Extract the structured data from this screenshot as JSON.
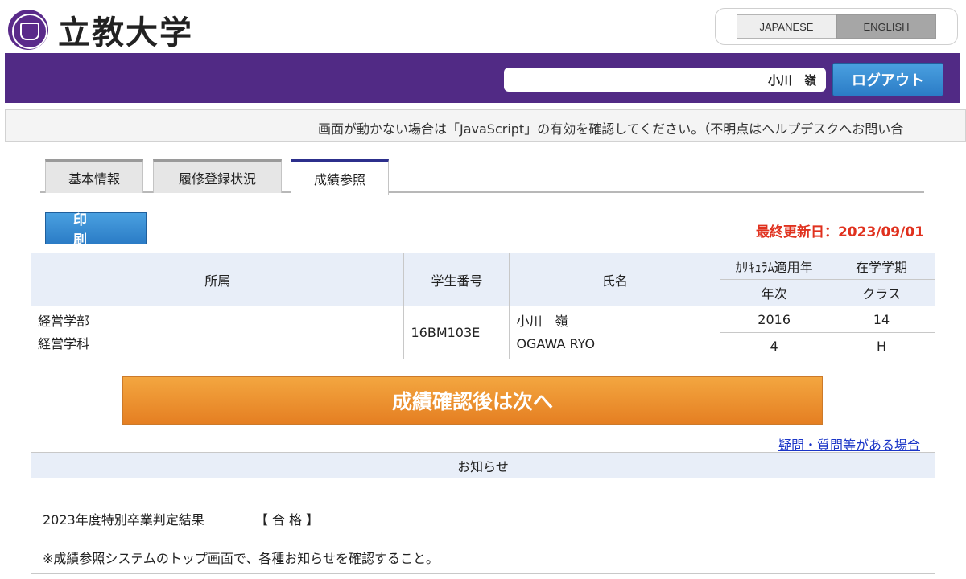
{
  "header": {
    "logo_text": "立教大学",
    "lang_japanese": "JAPANESE",
    "lang_english": "ENGLISH"
  },
  "user_bar": {
    "user_name": "小川　嶺",
    "logout_label": "ログアウト"
  },
  "notice_bar": {
    "text": "画面が動かない場合は「JavaScript」の有効を確認してください。（不明点はヘルプデスクへお問い合"
  },
  "tabs": [
    {
      "label": "基本情報",
      "active": false
    },
    {
      "label": "履修登録状況",
      "active": false
    },
    {
      "label": "成績参照",
      "active": true
    }
  ],
  "toolbar": {
    "print_label": "印刷",
    "last_update": "最終更新日：2023/09/01"
  },
  "info_table": {
    "headers": {
      "affiliation": "所属",
      "student_id": "学生番号",
      "name": "氏名",
      "curriculum_year": "ｶﾘｷｭﾗﾑ適用年",
      "enrollment_term": "在学学期",
      "grade_year": "年次",
      "class": "クラス"
    },
    "values": {
      "faculty": "経営学部",
      "department": "経営学科",
      "student_id": "16BM103E",
      "name_kanji": "小川　嶺",
      "name_roman": "OGAWA RYO",
      "curriculum_year": "2016",
      "enrollment_term": "14",
      "grade_year": "4",
      "class": "H"
    }
  },
  "next_button": {
    "label": "成績確認後は次へ"
  },
  "question_link": {
    "label": "疑問・質問等がある場合"
  },
  "announcements": {
    "title": "お知らせ",
    "result_label": "2023年度特別卒業判定結果",
    "result_value": "【 合 格 】",
    "note": "※成績参照システムのトップ画面で、各種お知らせを確認すること。"
  },
  "colors": {
    "brand_purple": "#512a85",
    "button_blue": "#2b7cc6",
    "next_orange": "#e98a2b",
    "alert_red": "#e0311e",
    "link_blue": "#1a35c7"
  }
}
